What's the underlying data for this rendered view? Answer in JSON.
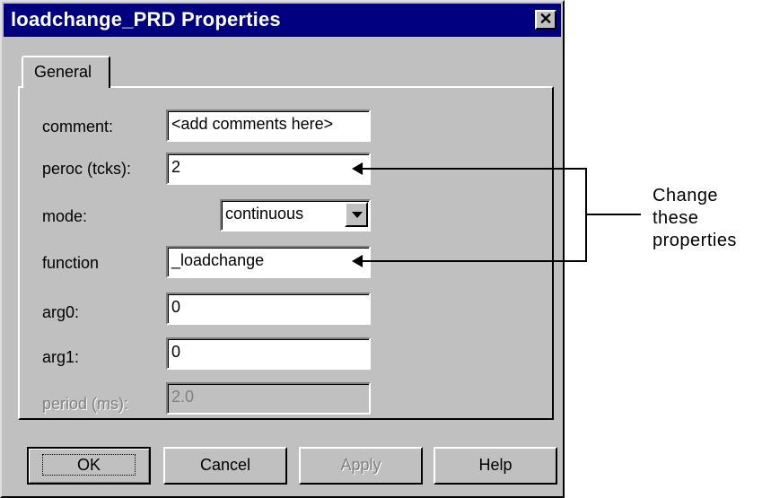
{
  "window": {
    "title": "loadchange_PRD Properties",
    "close_symbol": "✕"
  },
  "tabs": [
    {
      "label": "General"
    }
  ],
  "form": {
    "comment": {
      "label": "comment:",
      "value": "<add comments here>"
    },
    "period_ticks": {
      "label": "peroc (tcks):",
      "value": "2"
    },
    "mode": {
      "label": "mode:",
      "value": "continuous"
    },
    "function": {
      "label": "function",
      "value": "_loadchange"
    },
    "arg0": {
      "label": "arg0:",
      "value": "0"
    },
    "arg1": {
      "label": "arg1:",
      "value": "0"
    },
    "period_ms": {
      "label": "period (ms):",
      "value": "2.0"
    }
  },
  "buttons": {
    "ok": "OK",
    "cancel": "Cancel",
    "apply": "Apply",
    "help": "Help"
  },
  "annotation": {
    "line1": "Change",
    "line2": "these",
    "line3": "properties"
  }
}
